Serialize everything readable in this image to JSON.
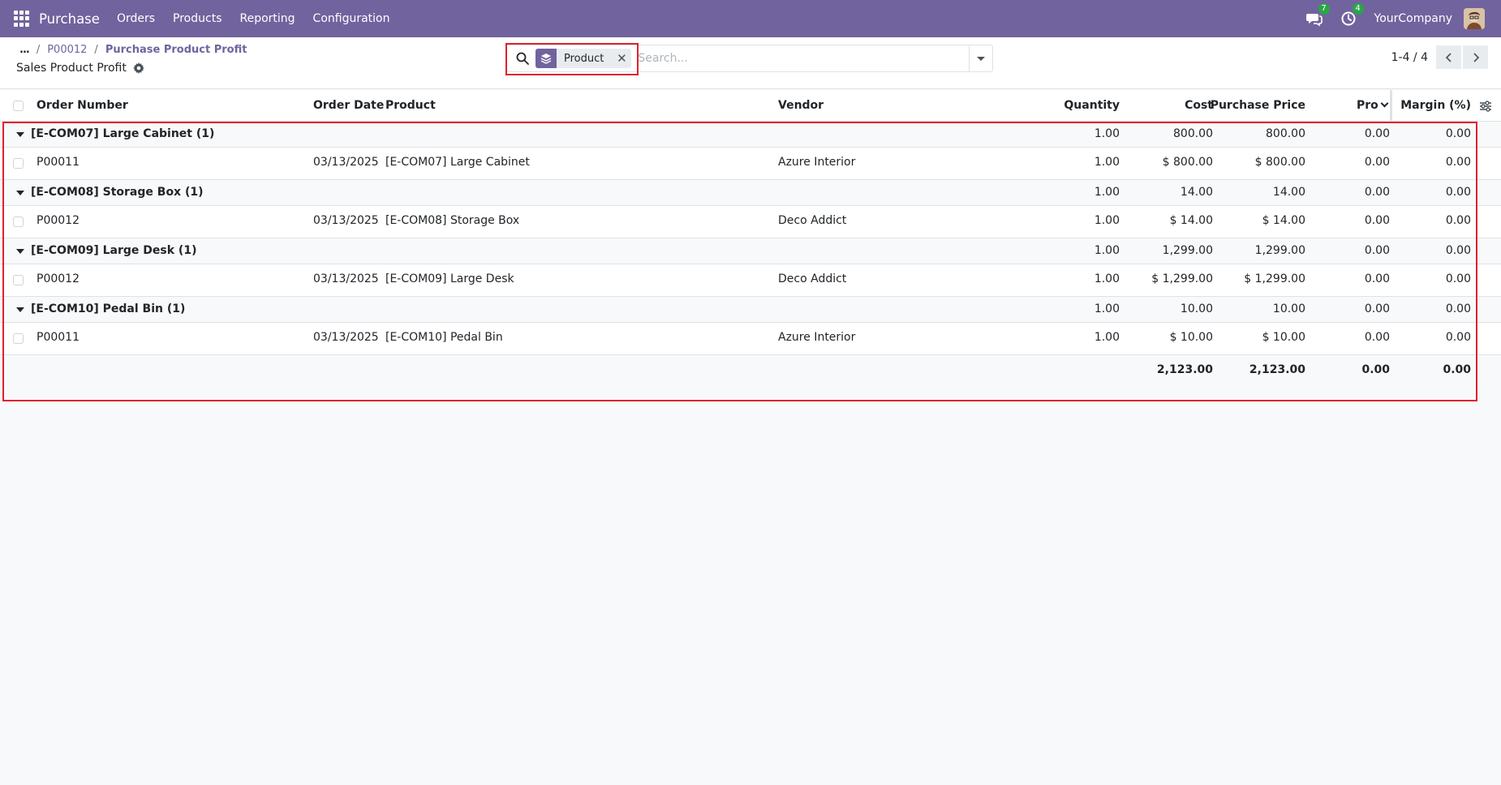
{
  "navbar": {
    "app_name": "Purchase",
    "menu": [
      "Orders",
      "Products",
      "Reporting",
      "Configuration"
    ],
    "messages_count": "7",
    "activities_count": "4",
    "company": "YourCompany",
    "icons": [
      "apps-grid-icon",
      "chat-icon",
      "clock-icon",
      "avatar"
    ],
    "color": "#71639e"
  },
  "breadcrumb": {
    "ellipsis": "...",
    "items": [
      "P00012",
      "Purchase Product Profit"
    ]
  },
  "view_title": "Sales Product Profit",
  "search": {
    "facet_label": "Product",
    "placeholder": "Search..."
  },
  "pager": {
    "value": "1-4 / 4"
  },
  "table": {
    "headers": {
      "order_number": "Order Number",
      "order_date": "Order Date",
      "product": "Product",
      "vendor": "Vendor",
      "quantity": "Quantity",
      "cost": "Cost",
      "purchase_price": "Purchase Price",
      "profit": "Pro",
      "margin": "Margin (%)"
    },
    "groups": [
      {
        "name": "[E-COM07] Large Cabinet (1)",
        "quantity": "1.00",
        "cost": "800.00",
        "purchase_price": "800.00",
        "profit": "0.00",
        "margin": "0.00",
        "row": {
          "order_number": "P00011",
          "order_date": "03/13/2025",
          "product": "[E-COM07] Large Cabinet",
          "vendor": "Azure Interior",
          "quantity": "1.00",
          "cost": "$ 800.00",
          "purchase_price": "$ 800.00",
          "profit": "0.00",
          "margin": "0.00"
        }
      },
      {
        "name": "[E-COM08] Storage Box (1)",
        "quantity": "1.00",
        "cost": "14.00",
        "purchase_price": "14.00",
        "profit": "0.00",
        "margin": "0.00",
        "row": {
          "order_number": "P00012",
          "order_date": "03/13/2025",
          "product": "[E-COM08] Storage Box",
          "vendor": "Deco Addict",
          "quantity": "1.00",
          "cost": "$ 14.00",
          "purchase_price": "$ 14.00",
          "profit": "0.00",
          "margin": "0.00"
        }
      },
      {
        "name": "[E-COM09] Large Desk (1)",
        "quantity": "1.00",
        "cost": "1,299.00",
        "purchase_price": "1,299.00",
        "profit": "0.00",
        "margin": "0.00",
        "row": {
          "order_number": "P00012",
          "order_date": "03/13/2025",
          "product": "[E-COM09] Large Desk",
          "vendor": "Deco Addict",
          "quantity": "1.00",
          "cost": "$ 1,299.00",
          "purchase_price": "$ 1,299.00",
          "profit": "0.00",
          "margin": "0.00"
        }
      },
      {
        "name": "[E-COM10] Pedal Bin (1)",
        "quantity": "1.00",
        "cost": "10.00",
        "purchase_price": "10.00",
        "profit": "0.00",
        "margin": "0.00",
        "row": {
          "order_number": "P00011",
          "order_date": "03/13/2025",
          "product": "[E-COM10] Pedal Bin",
          "vendor": "Azure Interior",
          "quantity": "1.00",
          "cost": "$ 10.00",
          "purchase_price": "$ 10.00",
          "profit": "0.00",
          "margin": "0.00"
        }
      }
    ],
    "totals": {
      "cost": "2,123.00",
      "purchase_price": "2,123.00",
      "profit": "0.00",
      "margin": "0.00"
    }
  }
}
